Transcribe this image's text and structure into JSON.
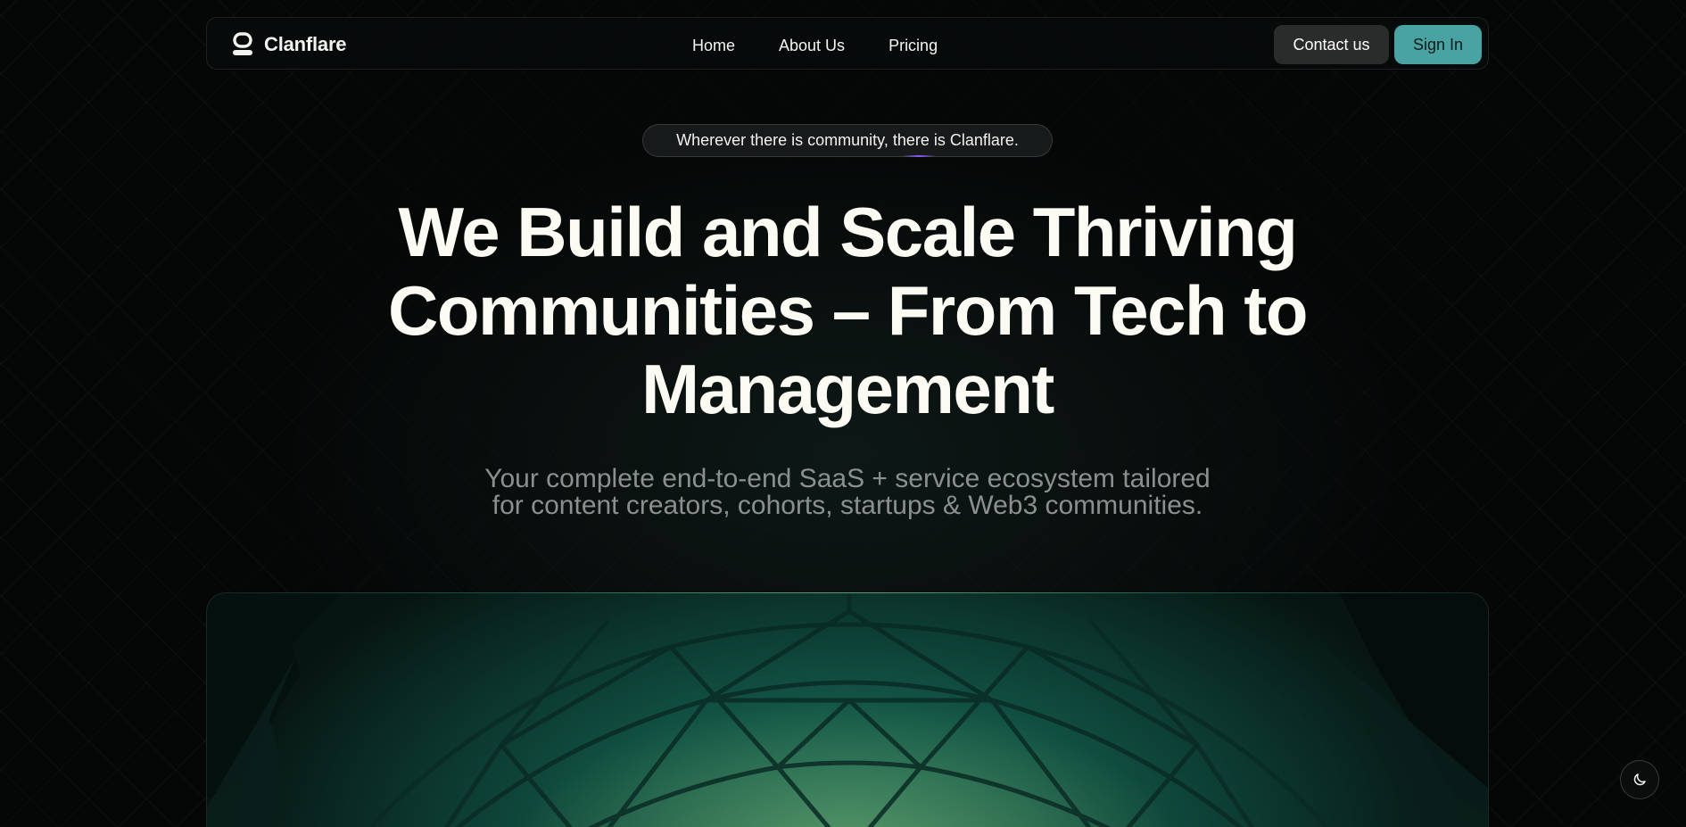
{
  "brand": {
    "name": "Clanflare",
    "icon": "clanflare-logo-icon"
  },
  "nav": {
    "links": [
      "Home",
      "About Us",
      "Pricing"
    ],
    "contact_label": "Contact us",
    "signin_label": "Sign In"
  },
  "hero": {
    "tagline": "Wherever there is community, there is Clanflare.",
    "title_lines": [
      "We Build and Scale Thriving",
      "Communities – From Tech to",
      "Management"
    ],
    "subtitle_lines": [
      "Your complete end-to-end SaaS + service ecosystem tailored",
      "for content creators, cohorts, startups & Web3 communities."
    ]
  },
  "theme_toggle": {
    "icon": "moon-icon"
  },
  "colors": {
    "accent": "#4aa3a3",
    "background": "#050707",
    "contact_button": "#2a2b2b",
    "title_text": "#fbfaf3",
    "subtitle_text": "#8c8f8f",
    "showcase_green": "#1e7a63"
  }
}
